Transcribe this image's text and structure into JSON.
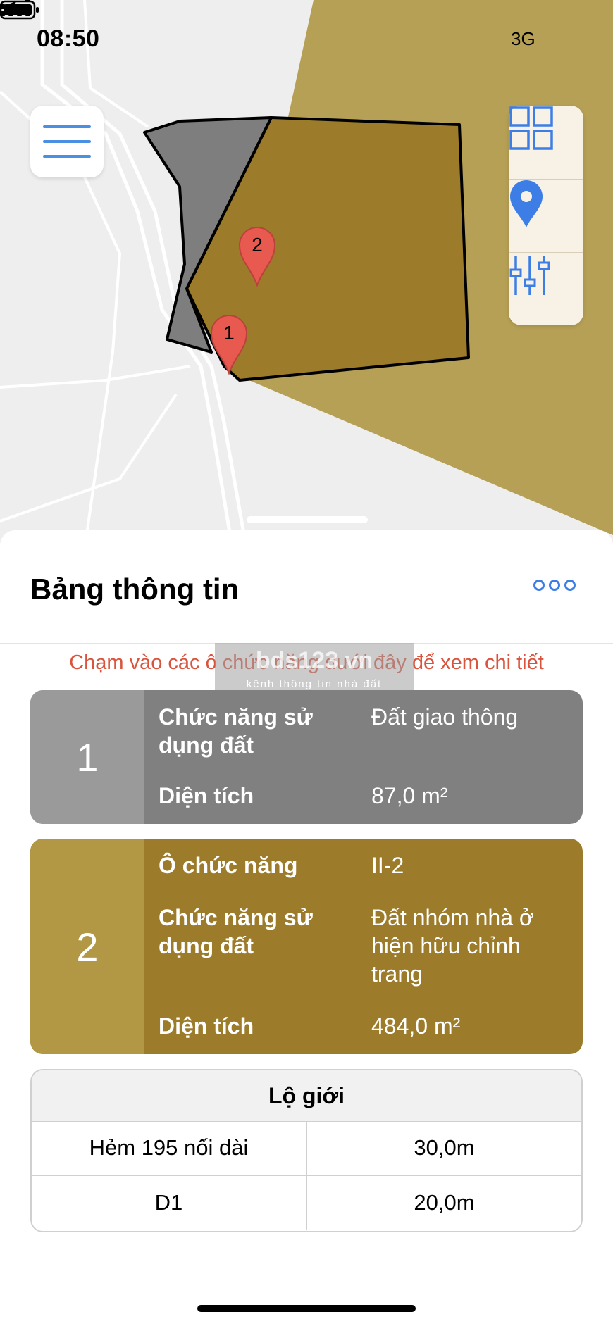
{
  "status_bar": {
    "time": "08:50",
    "network": "3G"
  },
  "sheet": {
    "title": "Bảng thông tin",
    "hint": "Chạm vào các ô chức năng dưới đây để xem chi tiết"
  },
  "watermark": {
    "main": "bds123.vn",
    "sub": "kênh thông tin nhà đất"
  },
  "map": {
    "markers": [
      {
        "label": "1"
      },
      {
        "label": "2"
      }
    ],
    "colors": {
      "plot_gray": "#7e7e7e",
      "plot_gold": "#9c7c2b",
      "zone_gold": "#b6a055",
      "marker_red": "#e8594f"
    }
  },
  "toolbar": {
    "icons": [
      "grid-icon",
      "location-pin-icon",
      "sliders-icon"
    ]
  },
  "plots": [
    {
      "number": "1",
      "color": "#808080",
      "rows": [
        {
          "label": "Chức năng sử dụng đất",
          "value": "Đất giao thông"
        },
        {
          "label": "Diện tích",
          "value": "87,0 m²"
        }
      ]
    },
    {
      "number": "2",
      "color": "#9c7c2b",
      "rows": [
        {
          "label": "Ô chức năng",
          "value": "II-2"
        },
        {
          "label": "Chức năng sử dụng đất",
          "value": "Đất nhóm nhà ở hiện hữu chỉnh trang"
        },
        {
          "label": "Diện tích",
          "value": "484,0 m²"
        }
      ]
    }
  ],
  "road_table": {
    "header": "Lộ giới",
    "rows": [
      {
        "name": "Hẻm 195 nối dài",
        "width": "30,0m"
      },
      {
        "name": "D1",
        "width": "20,0m"
      }
    ]
  }
}
